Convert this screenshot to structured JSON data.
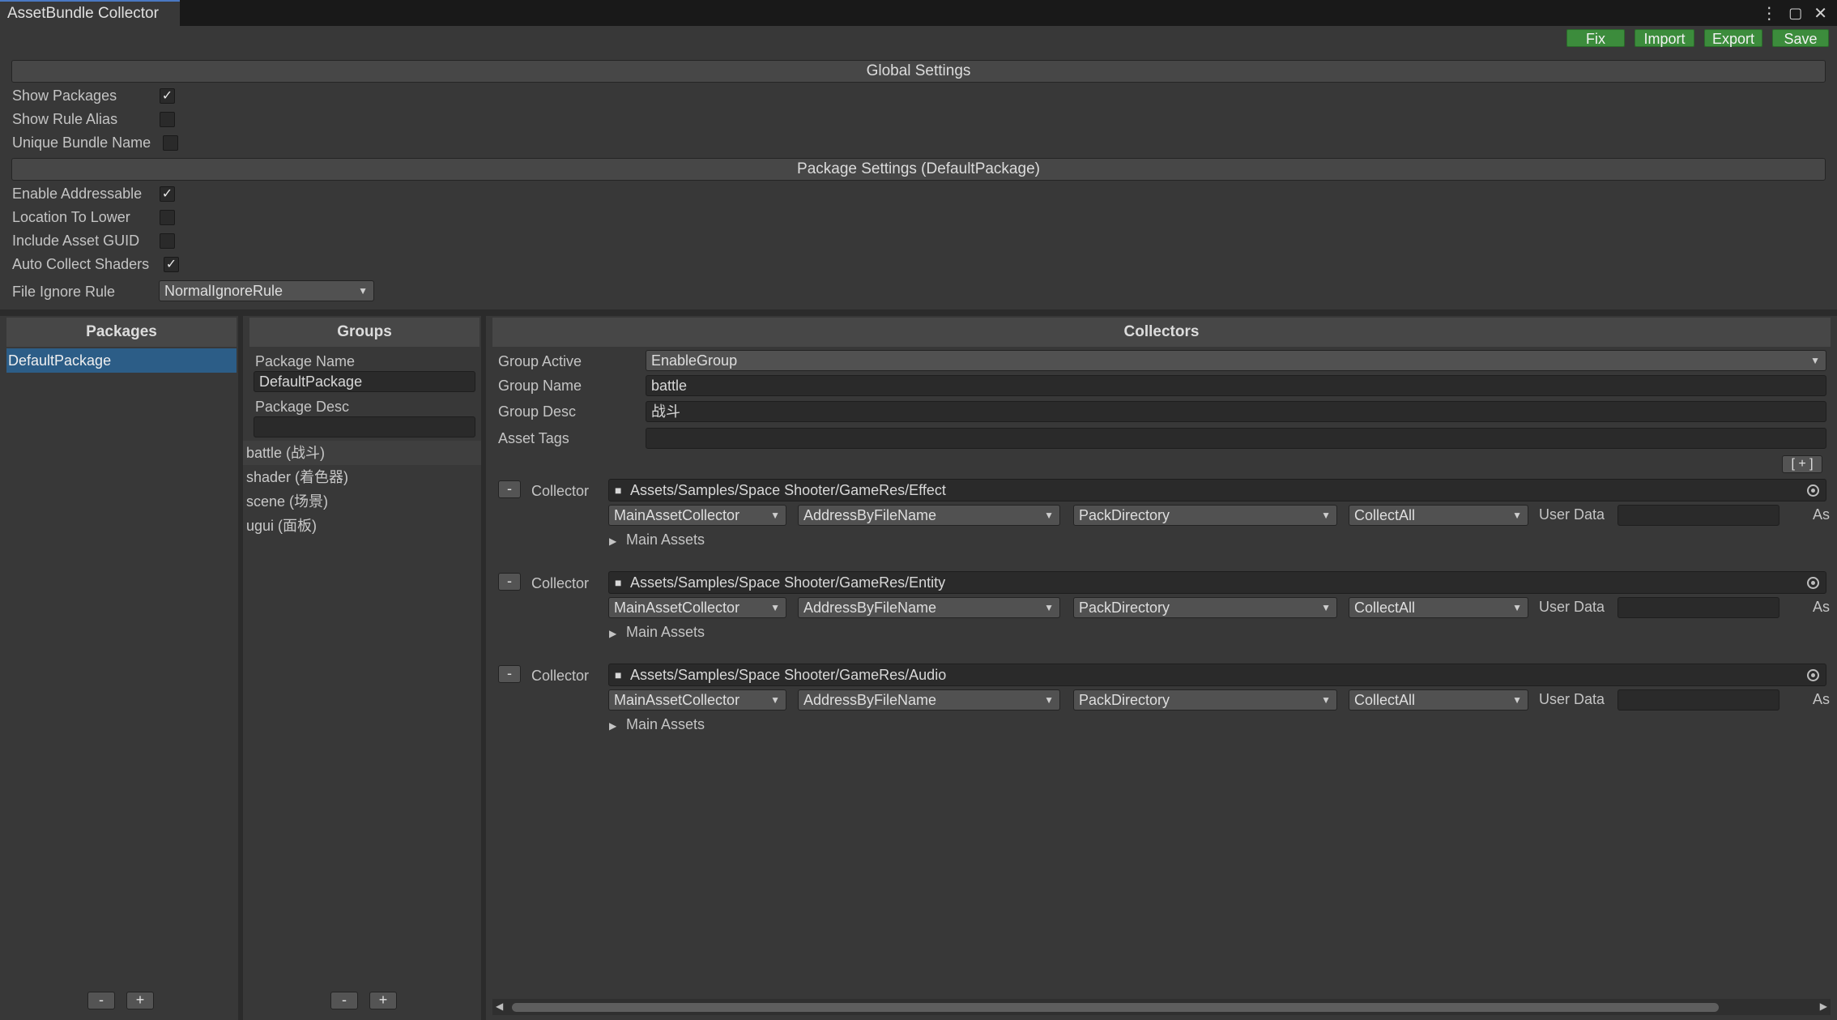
{
  "window": {
    "tab_title": "AssetBundle Collector",
    "controls": [
      "⋮",
      "🗖",
      "✕"
    ]
  },
  "toolbar": {
    "fix_label": "Fix",
    "import_label": "Import",
    "export_label": "Export",
    "save_label": "Save",
    "button_color": "#3c8c3c"
  },
  "global_settings": {
    "title": "Global Settings",
    "show_packages": {
      "label": "Show Packages",
      "checked": true
    },
    "show_rule_alias": {
      "label": "Show Rule Alias",
      "checked": false
    },
    "unique_bundle_name": {
      "label": "Unique Bundle Name",
      "checked": false
    }
  },
  "package_settings": {
    "title": "Package Settings (DefaultPackage)",
    "enable_addressable": {
      "label": "Enable Addressable",
      "checked": true
    },
    "location_to_lower": {
      "label": "Location To Lower",
      "checked": false
    },
    "include_asset_guid": {
      "label": "Include Asset GUID",
      "checked": false
    },
    "auto_collect_shaders": {
      "label": "Auto Collect Shaders",
      "checked": true
    },
    "file_ignore_rule": {
      "label": "File Ignore Rule",
      "value": "NormalIgnoreRule"
    }
  },
  "packages_panel": {
    "title": "Packages",
    "items": [
      {
        "label": "DefaultPackage",
        "selected": true
      }
    ],
    "remove_label": "-",
    "add_label": "+"
  },
  "groups_panel": {
    "title": "Groups",
    "package_name_label": "Package Name",
    "package_name_value": "DefaultPackage",
    "package_desc_label": "Package Desc",
    "package_desc_value": "",
    "items": [
      {
        "label": "battle (战斗)",
        "selected": true
      },
      {
        "label": "shader (着色器)",
        "selected": false
      },
      {
        "label": "scene (场景)",
        "selected": false
      },
      {
        "label": "ugui (面板)",
        "selected": false
      }
    ],
    "remove_label": "-",
    "add_label": "+"
  },
  "collectors_panel": {
    "title": "Collectors",
    "group_active_label": "Group Active",
    "group_active_value": "EnableGroup",
    "group_name_label": "Group Name",
    "group_name_value": "battle",
    "group_desc_label": "Group Desc",
    "group_desc_value": "战斗",
    "asset_tags_label": "Asset Tags",
    "asset_tags_value": "",
    "add_collector_label": "[ + ]",
    "collectors": [
      {
        "remove_label": "-",
        "label": "Collector",
        "path": "Assets/Samples/Space Shooter/GameRes/Effect",
        "collector_type": "MainAssetCollector",
        "address_rule": "AddressByFileName",
        "pack_rule": "PackDirectory",
        "filter_rule": "CollectAll",
        "user_data_label": "User Data",
        "user_data_value": "",
        "asset_tags_abbrev": "As",
        "main_assets_label": "Main Assets"
      },
      {
        "remove_label": "-",
        "label": "Collector",
        "path": "Assets/Samples/Space Shooter/GameRes/Entity",
        "collector_type": "MainAssetCollector",
        "address_rule": "AddressByFileName",
        "pack_rule": "PackDirectory",
        "filter_rule": "CollectAll",
        "user_data_label": "User Data",
        "user_data_value": "",
        "asset_tags_abbrev": "As",
        "main_assets_label": "Main Assets"
      },
      {
        "remove_label": "-",
        "label": "Collector",
        "path": "Assets/Samples/Space Shooter/GameRes/Audio",
        "collector_type": "MainAssetCollector",
        "address_rule": "AddressByFileName",
        "pack_rule": "PackDirectory",
        "filter_rule": "CollectAll",
        "user_data_label": "User Data",
        "user_data_value": "",
        "asset_tags_abbrev": "As",
        "main_assets_label": "Main Assets"
      }
    ]
  }
}
